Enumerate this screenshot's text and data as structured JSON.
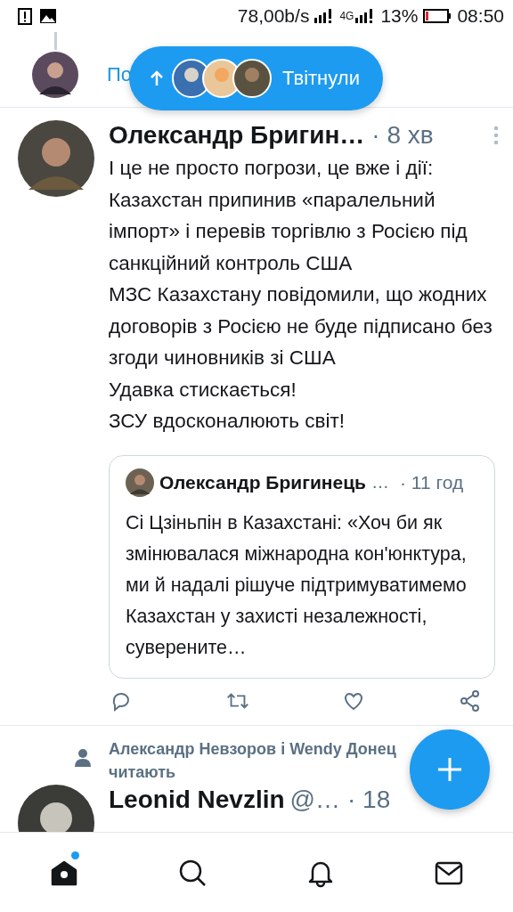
{
  "status_bar": {
    "speed": "78,00b/s",
    "network": "4G",
    "battery": "13%",
    "time": "08:50"
  },
  "previous_tweet": {
    "link": "По"
  },
  "new_tweets_pill": {
    "label": "Твітнули"
  },
  "tweet": {
    "name": "Олександр Бригин…",
    "time": "· 8 хв",
    "paragraphs": [
      "І це не просто погрози, це вже і дії: Казахстан припинив «паралельний імпорт» і перевів торгівлю з Росією під санкційний контроль США",
      "МЗС Казахстану повідомили, що жодних договорів з Росією не буде підписано без згоди чиновників зі США",
      "Удавка стискається!",
      "ЗСУ вдосконалюють світ!"
    ],
    "quote": {
      "name": "Олександр Бригинець",
      "ellipsis": "…",
      "time": "· 11 год",
      "text": "Сі Цзіньпін в Казахстані: «Хоч би як змінювалася міжнародна кон'юнктура, ми й надалі рішуче підтримуватимемо Казахстан у захисті незалежності, суверените…"
    }
  },
  "social_context": {
    "text": "Александр Невзоров і Wendy Донец",
    "action": "читають"
  },
  "next_tweet": {
    "name": "Leonid Nevzlin",
    "handle": "@…",
    "time": "· 18"
  },
  "nav": [
    {
      "kind": "home",
      "selected": true,
      "has_new": true
    },
    {
      "kind": "search",
      "selected": false,
      "has_new": false
    },
    {
      "kind": "notifications",
      "selected": false,
      "has_new": false
    },
    {
      "kind": "messages",
      "selected": false,
      "has_new": false
    }
  ]
}
